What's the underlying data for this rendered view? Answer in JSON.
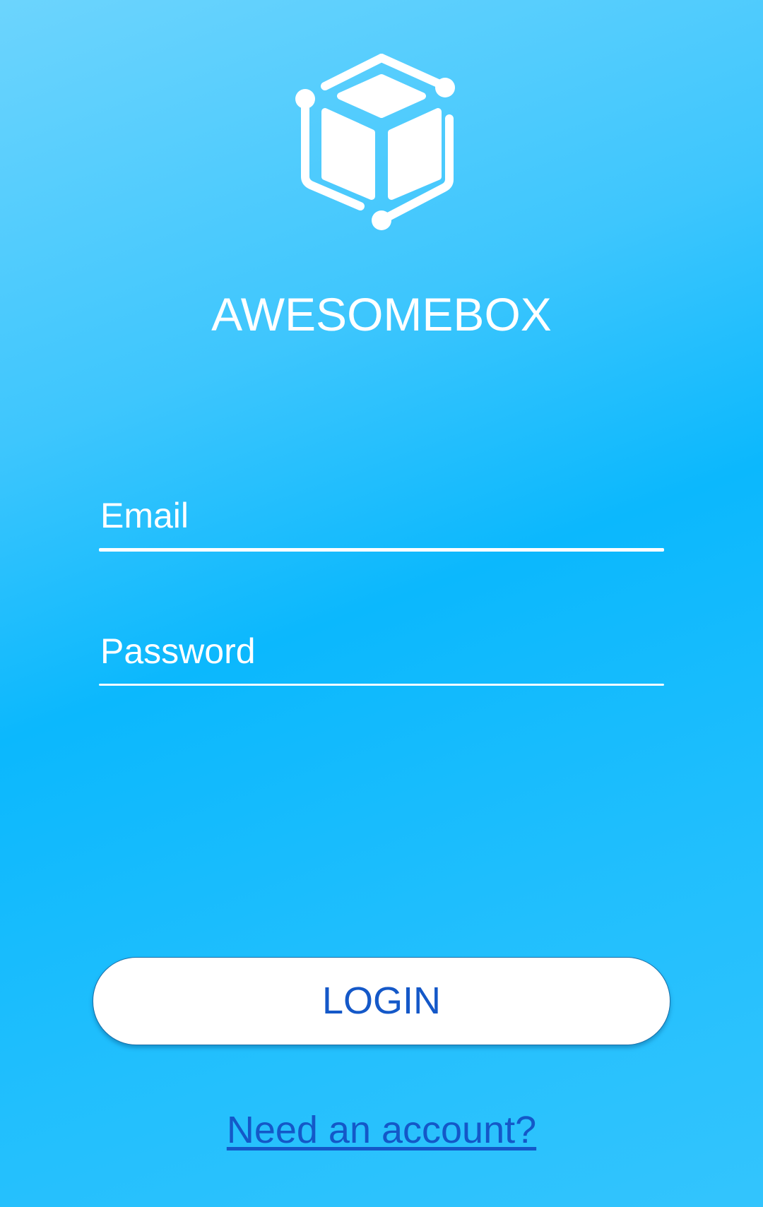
{
  "app": {
    "title": "AWESOMEBOX",
    "logo_icon": "cube-network-icon"
  },
  "form": {
    "email": {
      "placeholder": "Email",
      "value": ""
    },
    "password": {
      "placeholder": "Password",
      "value": ""
    },
    "login_label": "LOGIN",
    "signup_link": "Need an account?"
  },
  "colors": {
    "background_light": "#6cd4fd",
    "background_mid": "#0bb8fd",
    "button_background": "#ffffff",
    "button_text": "#1458c8",
    "link_text": "#1458c8",
    "text_white": "#ffffff"
  }
}
